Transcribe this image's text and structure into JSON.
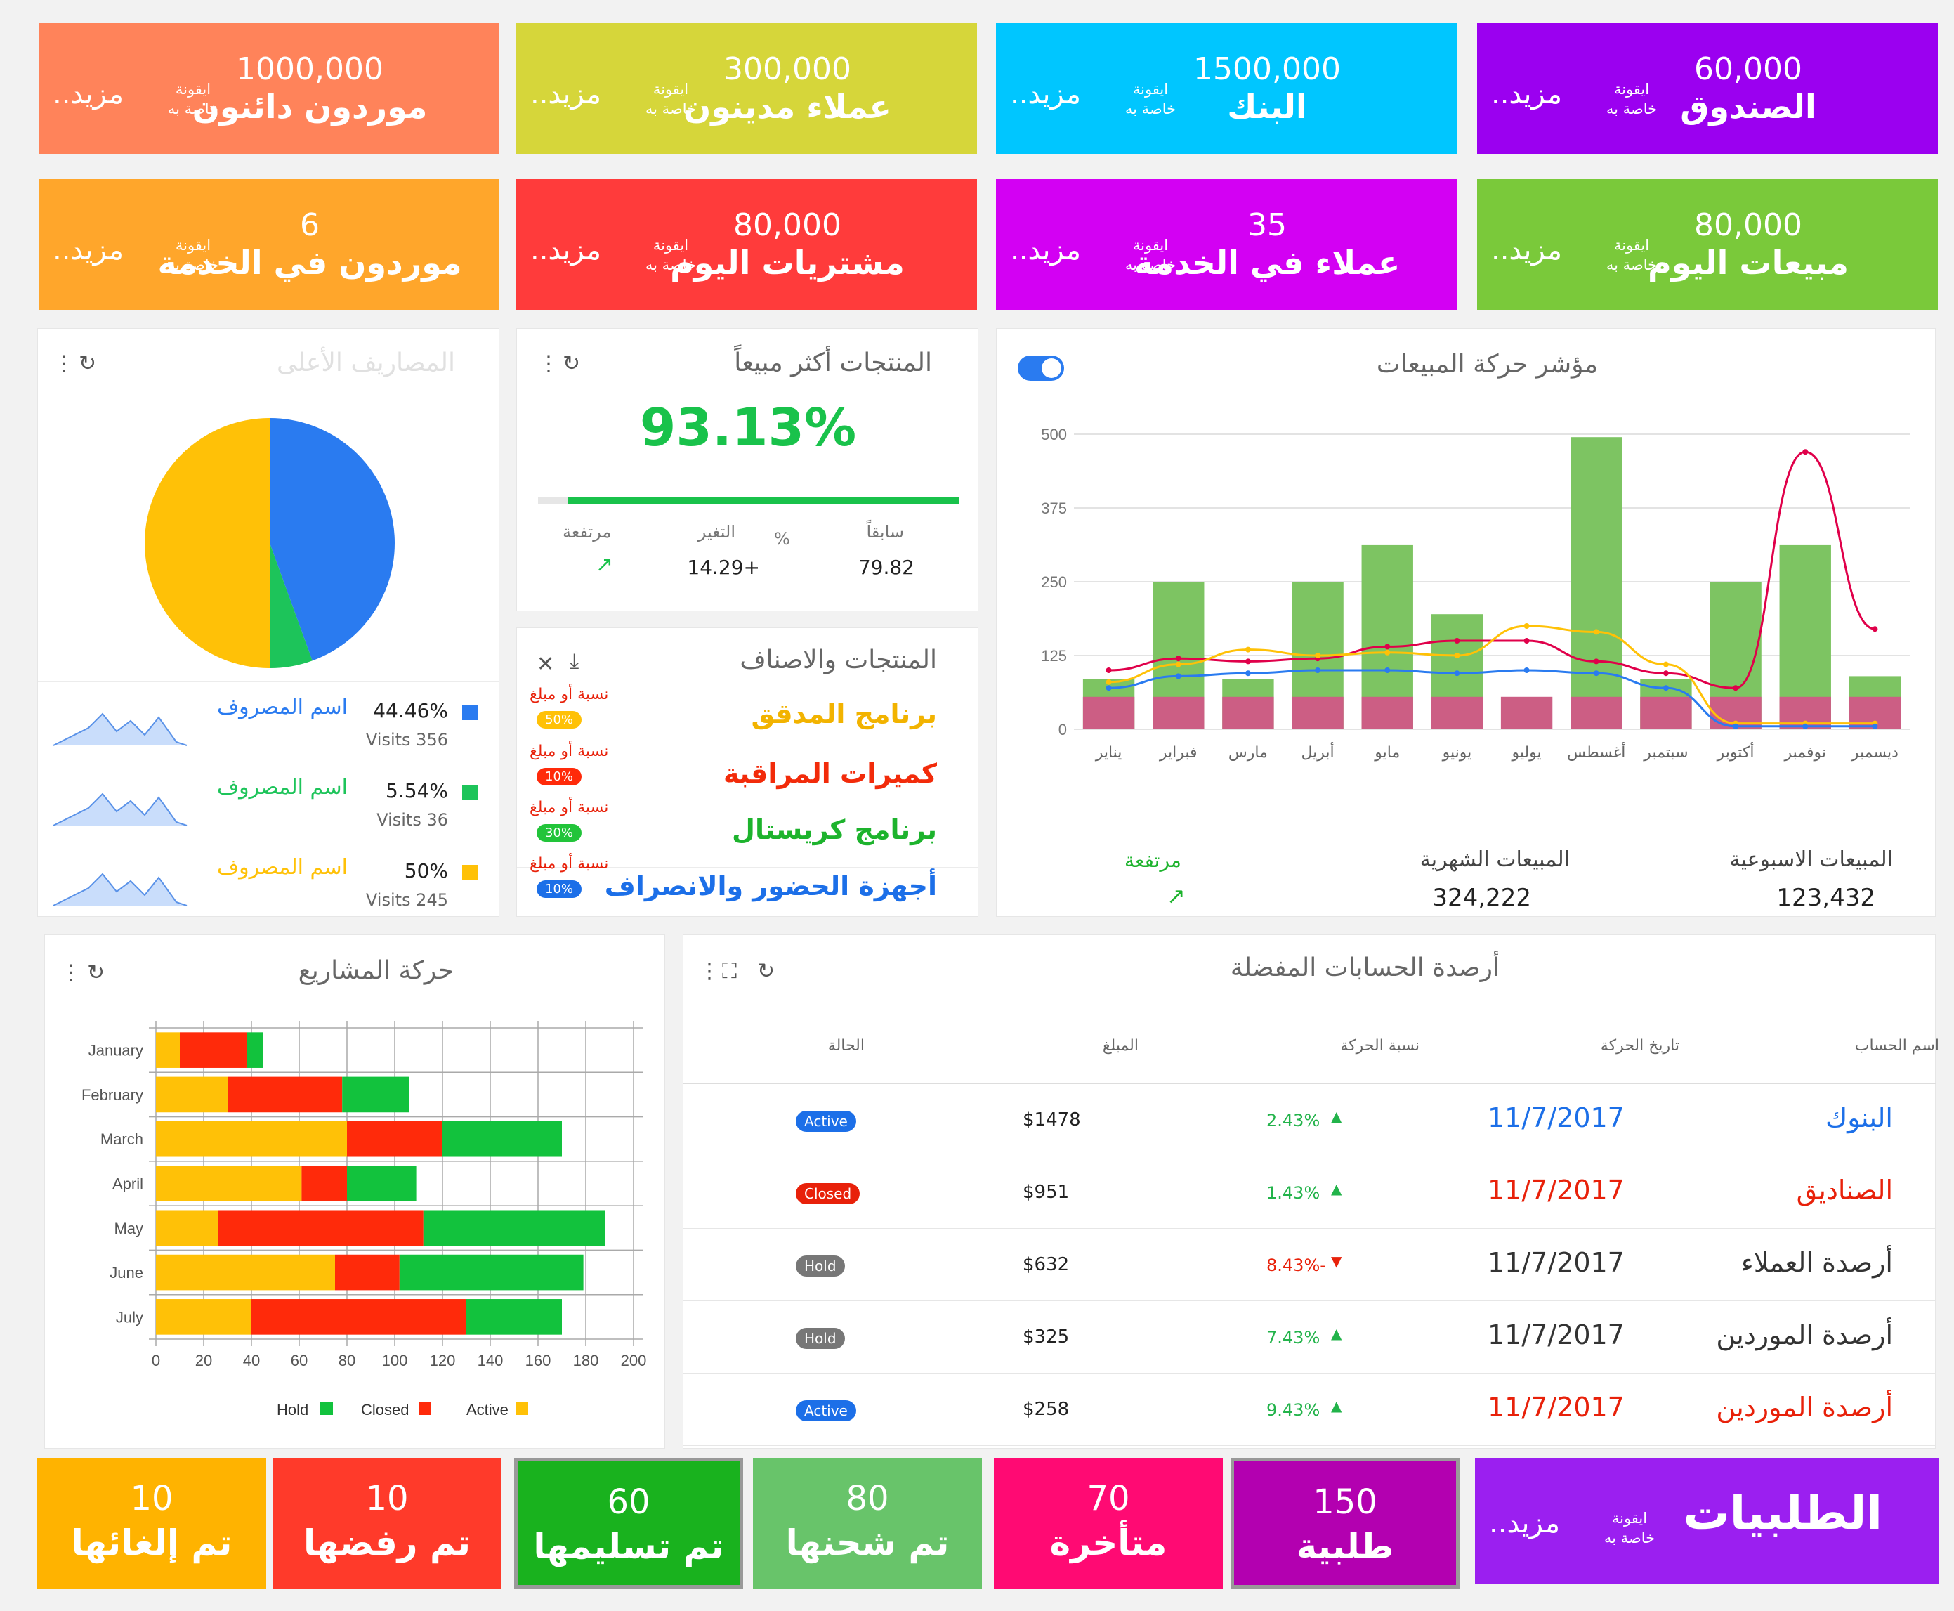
{
  "summary_tiles": [
    {
      "value": "60,000",
      "title": "الصندوق",
      "icon_text": "ايقونة خاصة به",
      "more": "مزيد..",
      "color": "#9B00F0"
    },
    {
      "value": "1500,000",
      "title": "البنك",
      "icon_text": "ايقونة خاصة به",
      "more": "مزيد..",
      "color": "#00C6FF"
    },
    {
      "value": "300,000",
      "title": "عملاء مدينون",
      "icon_text": "ايقونة خاصة به",
      "more": "مزيد..",
      "color": "#D6D63A"
    },
    {
      "value": "1000,000",
      "title": "موردون دائنون",
      "icon_text": "ايقونة خاصة به",
      "more": "مزيد..",
      "color": "#FF835A"
    },
    {
      "value": "80,000",
      "title": "مبيعات اليوم",
      "icon_text": "ايقونة خاصة به",
      "more": "مزيد..",
      "color": "#7AC93A"
    },
    {
      "value": "35",
      "title": "عملاء في الخدمة",
      "icon_text": "ايقونة خاصة به",
      "more": "مزيد..",
      "color": "#D300F3"
    },
    {
      "value": "80,000",
      "title": "مشتريات اليوم",
      "icon_text": "ايقونة خاصة به",
      "more": "مزيد..",
      "color": "#FF3B3B"
    },
    {
      "value": "6",
      "title": "موردون في الخدمة",
      "icon_text": "ايقونة خاصة به",
      "more": "مزيد..",
      "color": "#FFA62B"
    }
  ],
  "sales_chart": {
    "title": "مؤشر حركة المبيعات",
    "weekly_label": "المبيعات الاسبوعية",
    "weekly_value": "123,432",
    "monthly_label": "المبيعات الشهرية",
    "monthly_value": "324,222",
    "trend_label": "مرتفعة"
  },
  "best_products": {
    "title": "المنتجات أكثر مبيعاً",
    "percent": "93.13%",
    "progress": 0.93,
    "prev_label": "سابقاً",
    "prev_value": "79.82",
    "pct_symbol": "%",
    "change_label": "التغير",
    "change_value": "14.29+",
    "trend_label": "مرتفعة"
  },
  "products_list": {
    "title": "المنتجات والاصناف",
    "ratio_label": "نسبة أو مبلغ",
    "items": [
      {
        "name": "برنامج المدقق",
        "badge": "50%",
        "color": "#F2B300",
        "badge_color": "#FFC107"
      },
      {
        "name": "كميرات المراقبة",
        "badge": "10%",
        "color": "#F22B0A",
        "badge_color": "#FF2A0A"
      },
      {
        "name": "برنامج كريستال",
        "badge": "30%",
        "color": "#1DB32D",
        "badge_color": "#22C43A"
      },
      {
        "name": "أجهزة الحضور والانصراف",
        "badge": "10%",
        "color": "#1C6FE8",
        "badge_color": "#1C6FE8"
      }
    ]
  },
  "top_expenses": {
    "title": "المصاريف الأعلى",
    "items": [
      {
        "pct": "44.46%",
        "visits": "Visits 356",
        "name": "اسم المصروف",
        "color": "#2A7BF0"
      },
      {
        "pct": "5.54%",
        "visits": "Visits 36",
        "name": "اسم المصروف",
        "color": "#1DC45A"
      },
      {
        "pct": "50%",
        "visits": "Visits 245",
        "name": "اسم المصروف",
        "color": "#FFC107"
      }
    ]
  },
  "projects": {
    "title": "حركة المشاريع"
  },
  "accounts": {
    "title": "أرصدة الحسابات المفضلة",
    "headers": [
      "اسم الحساب",
      "تاريخ الحركة",
      "نسبة الحركة",
      "المبلغ",
      "الحالة"
    ],
    "rows": [
      {
        "name": "البنوك",
        "date": "11/7/2017",
        "rate": "2.43%",
        "amount": "$1478",
        "status": "Active",
        "name_color": "#1C6FE8",
        "date_color": "#1C6FE8",
        "rate_color": "#22B34A",
        "status_color": "#1C6FE8",
        "dir": "up"
      },
      {
        "name": "الصناديق",
        "date": "11/7/2017",
        "rate": "1.43%",
        "amount": "$951",
        "status": "Closed",
        "name_color": "#E8210A",
        "date_color": "#E8210A",
        "rate_color": "#22B34A",
        "status_color": "#E8210A",
        "dir": "up"
      },
      {
        "name": "أرصدة العملاء",
        "date": "11/7/2017",
        "rate": "8.43%-",
        "amount": "$632",
        "status": "Hold",
        "name_color": "#333333",
        "date_color": "#333333",
        "rate_color": "#E8210A",
        "status_color": "#777777",
        "dir": "down"
      },
      {
        "name": "أرصدة الموردين",
        "date": "11/7/2017",
        "rate": "7.43%",
        "amount": "$325",
        "status": "Hold",
        "name_color": "#333333",
        "date_color": "#333333",
        "rate_color": "#22B34A",
        "status_color": "#777777",
        "dir": "up"
      },
      {
        "name": "أرصدة الموردين",
        "date": "11/7/2017",
        "rate": "9.43%",
        "amount": "$258",
        "status": "Active",
        "name_color": "#E8210A",
        "date_color": "#E8210A",
        "rate_color": "#22B34A",
        "status_color": "#1C6FE8",
        "dir": "up"
      }
    ]
  },
  "orders": {
    "title": "الطلبيات",
    "icon_text": "ايقونة خاصة به",
    "more": "مزيد..",
    "tiles": [
      {
        "value": "150",
        "label": "طلبية",
        "color": "#B300B0"
      },
      {
        "value": "70",
        "label": "متأخرة",
        "color": "#FF0A73"
      },
      {
        "value": "80",
        "label": "تم شحنها",
        "color": "#68C46A"
      },
      {
        "value": "60",
        "label": "تم تسليمها",
        "color": "#19B21E"
      },
      {
        "value": "10",
        "label": "تم رفضها",
        "color": "#FF3A2A"
      },
      {
        "value": "10",
        "label": "تم إلغائها",
        "color": "#FFB300"
      }
    ]
  },
  "chart_data": [
    {
      "type": "bar",
      "title": "مؤشر حركة المبيعات",
      "categories": [
        "يناير",
        "فبراير",
        "مارس",
        "أبريل",
        "مايو",
        "يونيو",
        "يوليو",
        "أغسطس",
        "سبتمبر",
        "أكتوبر",
        "نوفمبر",
        "ديسمبر"
      ],
      "y_ticks": [
        0,
        125,
        250,
        375,
        500
      ],
      "ylim": [
        0,
        500
      ],
      "series": [
        {
          "values": [
            85,
            250,
            85,
            250,
            312,
            195,
            0,
            495,
            85,
            250,
            312,
            90
          ],
          "color": "#7DC462"
        },
        {
          "values": [
            55,
            55,
            55,
            55,
            55,
            55,
            55,
            55,
            55,
            55,
            55,
            55
          ],
          "color": "#CC5E84"
        },
        {
          "values": [
            100,
            120,
            115,
            120,
            140,
            150,
            150,
            115,
            95,
            70,
            470,
            170
          ],
          "color": "#E0004A",
          "kind": "line"
        },
        {
          "values": [
            80,
            110,
            135,
            125,
            130,
            125,
            175,
            165,
            110,
            10,
            10,
            10
          ],
          "color": "#FFC107",
          "kind": "line"
        },
        {
          "values": [
            70,
            90,
            95,
            100,
            100,
            95,
            100,
            95,
            70,
            5,
            5,
            5
          ],
          "color": "#2A7BF0",
          "kind": "line"
        }
      ]
    },
    {
      "type": "pie",
      "slices": [
        {
          "value": 44.46,
          "color": "#2A7BF0"
        },
        {
          "value": 5.54,
          "color": "#1DC45A"
        },
        {
          "value": 50,
          "color": "#FFC107"
        }
      ]
    },
    {
      "type": "bar",
      "orientation": "horizontal",
      "title": "حركة المشاريع",
      "categories": [
        "January",
        "February",
        "March",
        "April",
        "May",
        "June",
        "July"
      ],
      "x_ticks": [
        0,
        20,
        40,
        60,
        80,
        100,
        120,
        140,
        160,
        180,
        200
      ],
      "xlim": [
        0,
        200
      ],
      "series": [
        {
          "name": "Active",
          "color": "#FFC107",
          "values": [
            10,
            30,
            80,
            61,
            26,
            75,
            40
          ]
        },
        {
          "name": "Closed",
          "color": "#FF2A0A",
          "values": [
            28,
            48,
            40,
            19,
            86,
            27,
            90
          ]
        },
        {
          "name": "Hold",
          "color": "#12C23D",
          "values": [
            7,
            28,
            50,
            29,
            76,
            77,
            40
          ]
        }
      ]
    }
  ]
}
